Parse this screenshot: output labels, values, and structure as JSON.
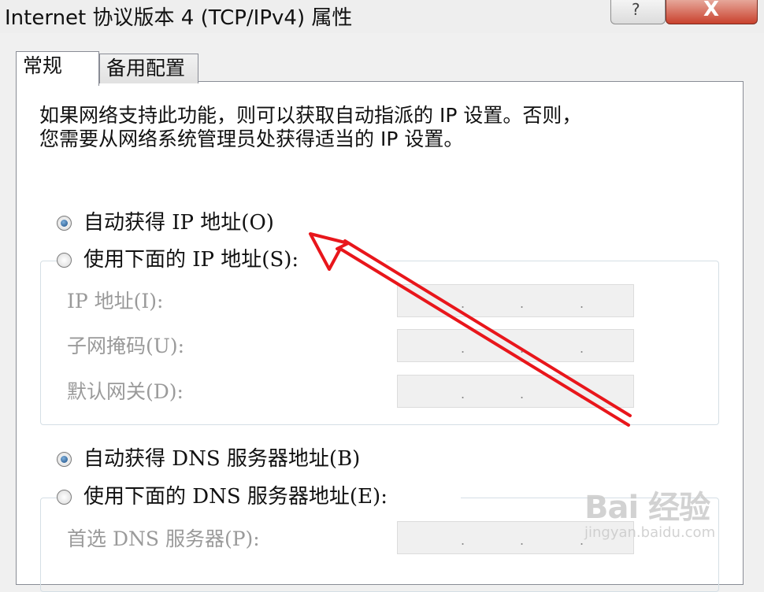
{
  "window": {
    "title": "Internet 协议版本 4 (TCP/IPv4) 属性",
    "help_label": "?",
    "close_label": "X"
  },
  "tabs": [
    {
      "label": "常规",
      "active": true
    },
    {
      "label": "备用配置",
      "active": false
    }
  ],
  "description": "如果网络支持此功能，则可以获取自动指派的 IP 设置。否则，\n您需要从网络系统管理员处获得适当的 IP 设置。",
  "ip_section": {
    "auto_label": "自动获得 IP 地址(O)",
    "auto_checked": true,
    "manual_label": "使用下面的 IP 地址(S):",
    "manual_checked": false,
    "fields": [
      {
        "label": "IP 地址(I):",
        "value": ". . ."
      },
      {
        "label": "子网掩码(U):",
        "value": ". . ."
      },
      {
        "label": "默认网关(D):",
        "value": ". . ."
      }
    ]
  },
  "dns_section": {
    "auto_label": "自动获得 DNS 服务器地址(B)",
    "auto_checked": true,
    "manual_label": "使用下面的 DNS 服务器地址(E):",
    "manual_checked": false,
    "fields": [
      {
        "label": "首选 DNS 服务器(P):",
        "value": ". . ."
      }
    ]
  },
  "annotation": {
    "color": "#e8161b"
  },
  "watermark": {
    "logo": "Bai 经验",
    "sub": "jingyan.baidu.com"
  }
}
